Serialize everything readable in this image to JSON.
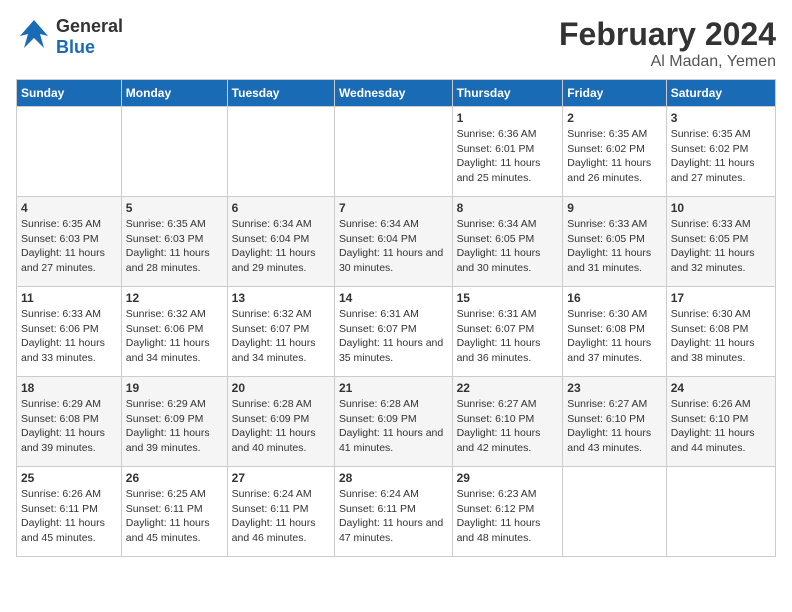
{
  "header": {
    "logo_general": "General",
    "logo_blue": "Blue",
    "month_year": "February 2024",
    "location": "Al Madan, Yemen"
  },
  "weekdays": [
    "Sunday",
    "Monday",
    "Tuesday",
    "Wednesday",
    "Thursday",
    "Friday",
    "Saturday"
  ],
  "weeks": [
    [
      {
        "day": "",
        "sunrise": "",
        "sunset": "",
        "daylight": ""
      },
      {
        "day": "",
        "sunrise": "",
        "sunset": "",
        "daylight": ""
      },
      {
        "day": "",
        "sunrise": "",
        "sunset": "",
        "daylight": ""
      },
      {
        "day": "",
        "sunrise": "",
        "sunset": "",
        "daylight": ""
      },
      {
        "day": "1",
        "sunrise": "Sunrise: 6:36 AM",
        "sunset": "Sunset: 6:01 PM",
        "daylight": "Daylight: 11 hours and 25 minutes."
      },
      {
        "day": "2",
        "sunrise": "Sunrise: 6:35 AM",
        "sunset": "Sunset: 6:02 PM",
        "daylight": "Daylight: 11 hours and 26 minutes."
      },
      {
        "day": "3",
        "sunrise": "Sunrise: 6:35 AM",
        "sunset": "Sunset: 6:02 PM",
        "daylight": "Daylight: 11 hours and 27 minutes."
      }
    ],
    [
      {
        "day": "4",
        "sunrise": "Sunrise: 6:35 AM",
        "sunset": "Sunset: 6:03 PM",
        "daylight": "Daylight: 11 hours and 27 minutes."
      },
      {
        "day": "5",
        "sunrise": "Sunrise: 6:35 AM",
        "sunset": "Sunset: 6:03 PM",
        "daylight": "Daylight: 11 hours and 28 minutes."
      },
      {
        "day": "6",
        "sunrise": "Sunrise: 6:34 AM",
        "sunset": "Sunset: 6:04 PM",
        "daylight": "Daylight: 11 hours and 29 minutes."
      },
      {
        "day": "7",
        "sunrise": "Sunrise: 6:34 AM",
        "sunset": "Sunset: 6:04 PM",
        "daylight": "Daylight: 11 hours and 30 minutes."
      },
      {
        "day": "8",
        "sunrise": "Sunrise: 6:34 AM",
        "sunset": "Sunset: 6:05 PM",
        "daylight": "Daylight: 11 hours and 30 minutes."
      },
      {
        "day": "9",
        "sunrise": "Sunrise: 6:33 AM",
        "sunset": "Sunset: 6:05 PM",
        "daylight": "Daylight: 11 hours and 31 minutes."
      },
      {
        "day": "10",
        "sunrise": "Sunrise: 6:33 AM",
        "sunset": "Sunset: 6:05 PM",
        "daylight": "Daylight: 11 hours and 32 minutes."
      }
    ],
    [
      {
        "day": "11",
        "sunrise": "Sunrise: 6:33 AM",
        "sunset": "Sunset: 6:06 PM",
        "daylight": "Daylight: 11 hours and 33 minutes."
      },
      {
        "day": "12",
        "sunrise": "Sunrise: 6:32 AM",
        "sunset": "Sunset: 6:06 PM",
        "daylight": "Daylight: 11 hours and 34 minutes."
      },
      {
        "day": "13",
        "sunrise": "Sunrise: 6:32 AM",
        "sunset": "Sunset: 6:07 PM",
        "daylight": "Daylight: 11 hours and 34 minutes."
      },
      {
        "day": "14",
        "sunrise": "Sunrise: 6:31 AM",
        "sunset": "Sunset: 6:07 PM",
        "daylight": "Daylight: 11 hours and 35 minutes."
      },
      {
        "day": "15",
        "sunrise": "Sunrise: 6:31 AM",
        "sunset": "Sunset: 6:07 PM",
        "daylight": "Daylight: 11 hours and 36 minutes."
      },
      {
        "day": "16",
        "sunrise": "Sunrise: 6:30 AM",
        "sunset": "Sunset: 6:08 PM",
        "daylight": "Daylight: 11 hours and 37 minutes."
      },
      {
        "day": "17",
        "sunrise": "Sunrise: 6:30 AM",
        "sunset": "Sunset: 6:08 PM",
        "daylight": "Daylight: 11 hours and 38 minutes."
      }
    ],
    [
      {
        "day": "18",
        "sunrise": "Sunrise: 6:29 AM",
        "sunset": "Sunset: 6:08 PM",
        "daylight": "Daylight: 11 hours and 39 minutes."
      },
      {
        "day": "19",
        "sunrise": "Sunrise: 6:29 AM",
        "sunset": "Sunset: 6:09 PM",
        "daylight": "Daylight: 11 hours and 39 minutes."
      },
      {
        "day": "20",
        "sunrise": "Sunrise: 6:28 AM",
        "sunset": "Sunset: 6:09 PM",
        "daylight": "Daylight: 11 hours and 40 minutes."
      },
      {
        "day": "21",
        "sunrise": "Sunrise: 6:28 AM",
        "sunset": "Sunset: 6:09 PM",
        "daylight": "Daylight: 11 hours and 41 minutes."
      },
      {
        "day": "22",
        "sunrise": "Sunrise: 6:27 AM",
        "sunset": "Sunset: 6:10 PM",
        "daylight": "Daylight: 11 hours and 42 minutes."
      },
      {
        "day": "23",
        "sunrise": "Sunrise: 6:27 AM",
        "sunset": "Sunset: 6:10 PM",
        "daylight": "Daylight: 11 hours and 43 minutes."
      },
      {
        "day": "24",
        "sunrise": "Sunrise: 6:26 AM",
        "sunset": "Sunset: 6:10 PM",
        "daylight": "Daylight: 11 hours and 44 minutes."
      }
    ],
    [
      {
        "day": "25",
        "sunrise": "Sunrise: 6:26 AM",
        "sunset": "Sunset: 6:11 PM",
        "daylight": "Daylight: 11 hours and 45 minutes."
      },
      {
        "day": "26",
        "sunrise": "Sunrise: 6:25 AM",
        "sunset": "Sunset: 6:11 PM",
        "daylight": "Daylight: 11 hours and 45 minutes."
      },
      {
        "day": "27",
        "sunrise": "Sunrise: 6:24 AM",
        "sunset": "Sunset: 6:11 PM",
        "daylight": "Daylight: 11 hours and 46 minutes."
      },
      {
        "day": "28",
        "sunrise": "Sunrise: 6:24 AM",
        "sunset": "Sunset: 6:11 PM",
        "daylight": "Daylight: 11 hours and 47 minutes."
      },
      {
        "day": "29",
        "sunrise": "Sunrise: 6:23 AM",
        "sunset": "Sunset: 6:12 PM",
        "daylight": "Daylight: 11 hours and 48 minutes."
      },
      {
        "day": "",
        "sunrise": "",
        "sunset": "",
        "daylight": ""
      },
      {
        "day": "",
        "sunrise": "",
        "sunset": "",
        "daylight": ""
      }
    ]
  ]
}
